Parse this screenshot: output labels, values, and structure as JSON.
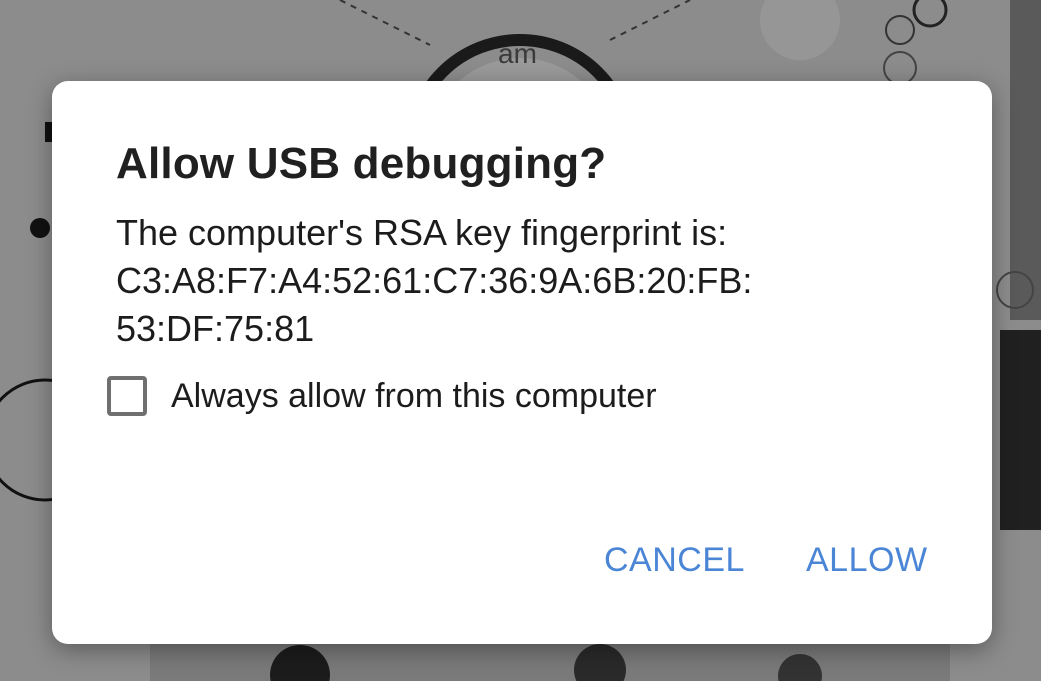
{
  "background": {
    "clock_label": "am"
  },
  "dialog": {
    "title": "Allow USB debugging?",
    "message_line1": "The computer's RSA key fingerprint is:",
    "fingerprint_line1": "C3:A8:F7:A4:52:61:C7:36:9A:6B:20:FB:",
    "fingerprint_line2": "53:DF:75:81",
    "checkbox": {
      "label": "Always allow from this computer",
      "checked": false
    },
    "buttons": {
      "cancel": "CANCEL",
      "allow": "ALLOW"
    }
  },
  "colors": {
    "accent": "#4a85d6",
    "dialog_background": "#ffffff",
    "scrim": "#8e8e8e"
  }
}
